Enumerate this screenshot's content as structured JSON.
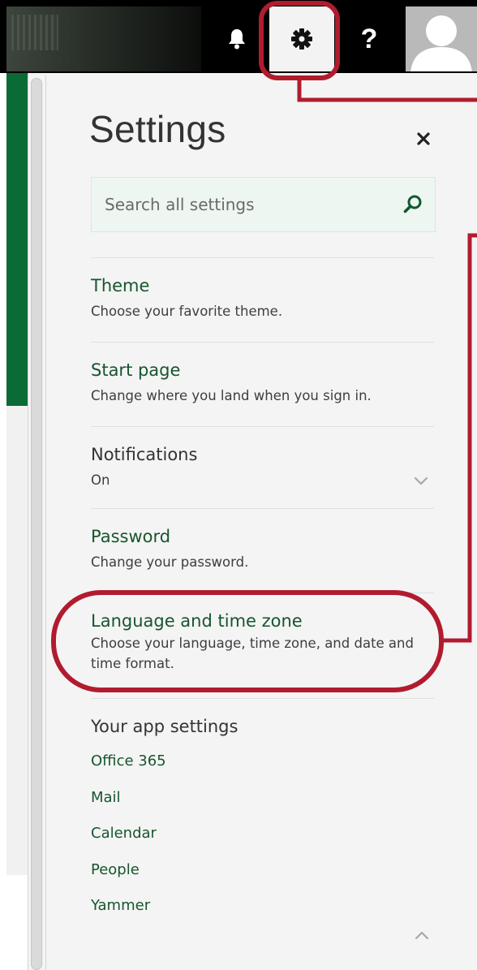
{
  "header": {
    "notifications_icon": "bell-icon",
    "settings_icon": "gear-icon",
    "help_icon": "help-icon",
    "help_glyph": "?",
    "avatar_icon": "person-icon"
  },
  "panel": {
    "title": "Settings",
    "close_icon": "close-icon",
    "search": {
      "placeholder": "Search all settings",
      "icon": "search-icon"
    },
    "items": [
      {
        "title": "Theme",
        "description": "Choose your favorite theme."
      },
      {
        "title": "Start page",
        "description": "Change where you land when you sign in."
      },
      {
        "title": "Notifications",
        "description": "On"
      },
      {
        "title": "Password",
        "description": "Change your password."
      },
      {
        "title": "Language and time zone",
        "description": "Choose your language, time zone, and date and time format."
      }
    ],
    "app_settings": {
      "heading": "Your app settings",
      "links": [
        "Office 365",
        "Mail",
        "Calendar",
        "People",
        "Yammer"
      ]
    }
  },
  "colors": {
    "accent_green": "#17552e",
    "sidebar_green": "#0b6b35",
    "annotation_red": "#b01c2e",
    "topbar": "#000000"
  }
}
